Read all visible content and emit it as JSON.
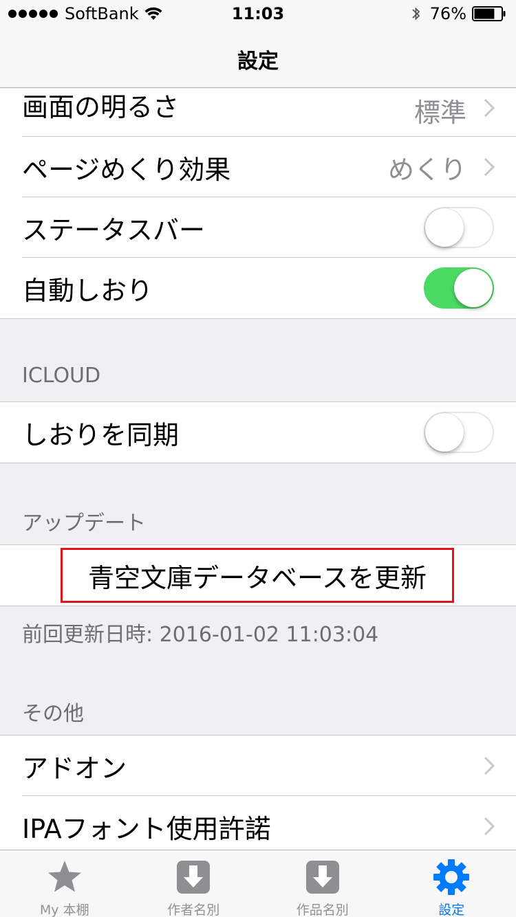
{
  "status_bar": {
    "carrier": "SoftBank",
    "time": "11:03",
    "battery": "76%",
    "battery_level": 0.76
  },
  "nav": {
    "title": "設定"
  },
  "display_section": {
    "rows": [
      {
        "label": "画面の明るさ",
        "value": "標準"
      },
      {
        "label": "ページめくり効果",
        "value": "めくり"
      },
      {
        "label": "ステータスバー",
        "toggle": false
      },
      {
        "label": "自動しおり",
        "toggle": true
      }
    ]
  },
  "icloud_section": {
    "header": "ICLOUD",
    "rows": [
      {
        "label": "しおりを同期",
        "toggle": false
      }
    ]
  },
  "update_section": {
    "header": "アップデート",
    "button_label": "青空文庫データベースを更新",
    "footer": "前回更新日時: 2016-01-02 11:03:04"
  },
  "other_section": {
    "header": "その他",
    "rows": [
      {
        "label": "アドオン"
      },
      {
        "label": "IPAフォント使用許諾"
      }
    ]
  },
  "tabs": [
    {
      "label": "My 本棚",
      "icon": "star-icon",
      "active": false
    },
    {
      "label": "作者名別",
      "icon": "download-icon",
      "active": false
    },
    {
      "label": "作品名別",
      "icon": "download-icon",
      "active": false
    },
    {
      "label": "設定",
      "icon": "gear-icon",
      "active": true
    }
  ],
  "colors": {
    "accent": "#007aff",
    "toggle_on": "#4cd964",
    "highlight_border": "#e4131a"
  }
}
